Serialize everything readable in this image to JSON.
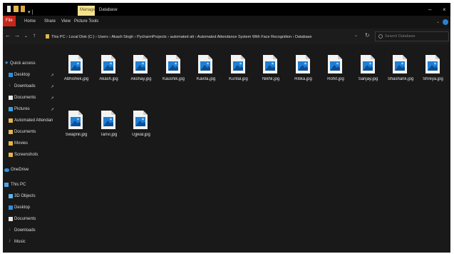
{
  "titlebar": {
    "manage": "Manage",
    "title": "Database",
    "minimize": "–",
    "close": "×"
  },
  "ribbon": {
    "file": "File",
    "tabs": [
      "Home",
      "Share",
      "View",
      "Picture Tools"
    ]
  },
  "addressbar": {
    "path": "This PC › Local Disk (C:) › Users › Akash Singh › PycharmProjects › automated att › Automated Attendance System With Face Recognition › Database",
    "search_placeholder": "Search Database"
  },
  "sidebar": {
    "items": [
      {
        "label": "Quick access",
        "icon": "star-icon"
      },
      {
        "label": "Desktop",
        "icon": "desktop-icon"
      },
      {
        "label": "Downloads",
        "icon": "download-icon"
      },
      {
        "label": "Documents",
        "icon": "documents-icon"
      },
      {
        "label": "Pictures",
        "icon": "pictures-icon"
      },
      {
        "label": "Automated Attendan",
        "icon": "folder-icon"
      },
      {
        "label": "Documents",
        "icon": "folder-icon"
      },
      {
        "label": "Movies",
        "icon": "folder-icon"
      },
      {
        "label": "Screenshots",
        "icon": "folder-icon"
      },
      {
        "label": "OneDrive",
        "icon": "cloud-icon"
      },
      {
        "label": "This PC",
        "icon": "pc-icon"
      },
      {
        "label": "3D Objects",
        "icon": "cube-icon"
      },
      {
        "label": "Desktop",
        "icon": "desktop-icon"
      },
      {
        "label": "Documents",
        "icon": "documents-icon"
      },
      {
        "label": "Downloads",
        "icon": "download-icon"
      },
      {
        "label": "Music",
        "icon": "music-icon"
      }
    ]
  },
  "files": [
    "Abhishek.jpg",
    "Akash.jpg",
    "Akshay.jpg",
    "Kaushik.jpg",
    "Kavita.jpg",
    "Kuntal.jpg",
    "Nikhil.jpg",
    "Ritika.jpg",
    "Rohit.jpg",
    "Sanjay.jpg",
    "Shashank.jpg",
    "Shreya.jpg",
    "Swapnil.jpg",
    "Tanvi.jpg",
    "Ujjwal.jpg"
  ]
}
